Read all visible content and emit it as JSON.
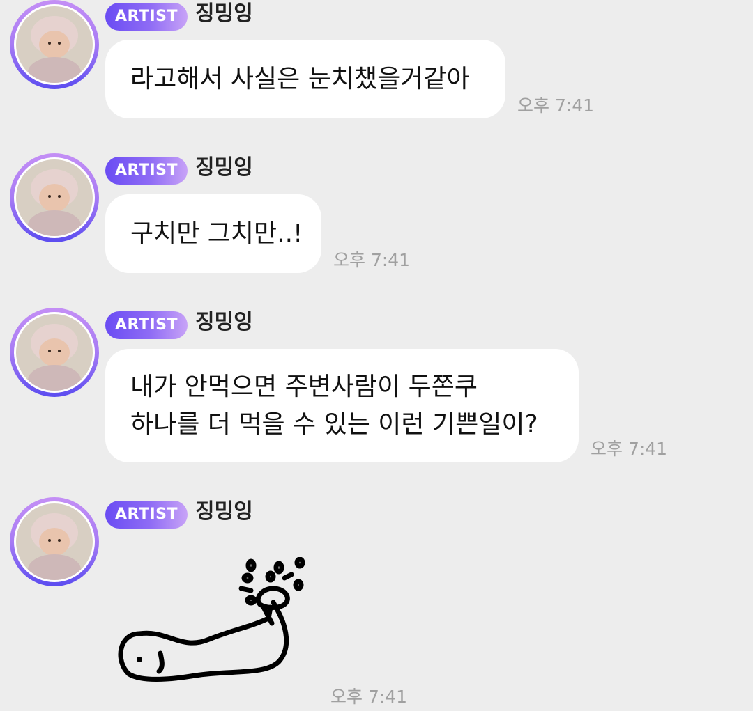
{
  "messages": [
    {
      "badge": "ARTIST",
      "sender": "징밍잉",
      "text": "라고해서 사실은 눈치챘을거같아",
      "time": "오후 7:41"
    },
    {
      "badge": "ARTIST",
      "sender": "징밍잉",
      "text": "구치만 그치만..!",
      "time": "오후 7:41"
    },
    {
      "badge": "ARTIST",
      "sender": "징밍잉",
      "text": "내가 안먹으면 주변사람이 두쫀쿠\n하나를 더 먹을 수 있는 이런 기쁜일이?",
      "time": "오후 7:41"
    },
    {
      "badge": "ARTIST",
      "sender": "징밍잉",
      "sticker": "whale-sticker",
      "time": "오후 7:41"
    }
  ],
  "icons": {
    "avatar": "baby-photo-avatar",
    "sticker": "spouting-whale-doodle"
  },
  "colors": {
    "background": "#ededed",
    "bubble": "#ffffff",
    "badge_start": "#6a4cf3",
    "badge_end": "#c8a3f7",
    "time": "#a0a0a0"
  }
}
